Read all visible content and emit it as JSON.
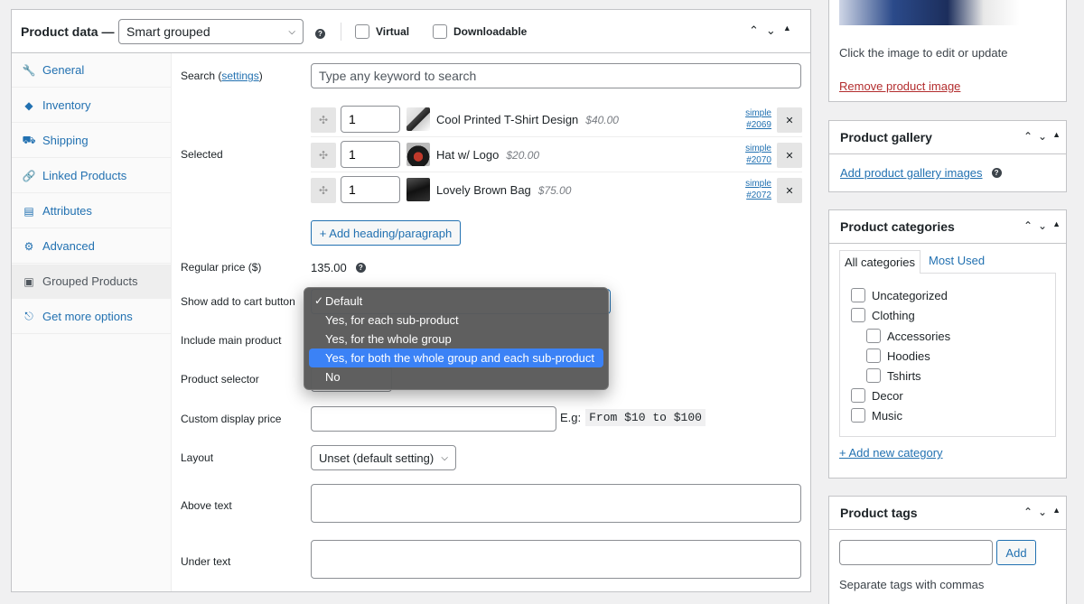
{
  "product_data": {
    "title": "Product data —",
    "type_select": "Smart grouped",
    "virtual_label": "Virtual",
    "downloadable_label": "Downloadable"
  },
  "tabs": [
    {
      "label": "General",
      "icon": "wrench-icon"
    },
    {
      "label": "Inventory",
      "icon": "tag-icon"
    },
    {
      "label": "Shipping",
      "icon": "truck-icon"
    },
    {
      "label": "Linked Products",
      "icon": "link-icon"
    },
    {
      "label": "Attributes",
      "icon": "list-icon"
    },
    {
      "label": "Advanced",
      "icon": "gear-icon"
    },
    {
      "label": "Grouped Products",
      "icon": "box-icon"
    },
    {
      "label": "Get more options",
      "icon": "plugin-icon"
    }
  ],
  "search": {
    "label_pre": "Search (",
    "label_link": "settings",
    "label_post": ")",
    "placeholder": "Type any keyword to search"
  },
  "selected": {
    "label": "Selected",
    "items": [
      {
        "qty": "1",
        "name": "Cool Printed T-Shirt Design",
        "price": "$40.00",
        "type": "simple",
        "id": "#2069"
      },
      {
        "qty": "1",
        "name": "Hat w/ Logo",
        "price": "$20.00",
        "type": "simple",
        "id": "#2070"
      },
      {
        "qty": "1",
        "name": "Lovely Brown Bag",
        "price": "$75.00",
        "type": "simple",
        "id": "#2072"
      }
    ],
    "add_heading_button": "+ Add heading/paragraph"
  },
  "regular_price": {
    "label": "Regular price ($)",
    "value": "135.00"
  },
  "add_to_cart": {
    "label": "Show add to cart button",
    "options": [
      {
        "label": "Default",
        "checked": true
      },
      {
        "label": "Yes, for each sub-product"
      },
      {
        "label": "Yes, for the whole group"
      },
      {
        "label": "Yes, for both the whole group and each sub-product",
        "highlighted": true
      },
      {
        "label": "No"
      }
    ]
  },
  "include_main": {
    "label": "Include main product"
  },
  "product_selector": {
    "label": "Product selector"
  },
  "custom_display_price": {
    "label": "Custom display price",
    "eg": "E.g:",
    "example": "From $10 to $100"
  },
  "layout": {
    "label": "Layout",
    "value": "Unset (default setting)"
  },
  "above_text": {
    "label": "Above text"
  },
  "under_text": {
    "label": "Under text"
  },
  "product_image": {
    "caption": "Click the image to edit or update",
    "remove_link": "Remove product image"
  },
  "gallery": {
    "title": "Product gallery",
    "add_link": "Add product gallery images"
  },
  "categories": {
    "title": "Product categories",
    "tab_all": "All categories",
    "tab_used": "Most Used",
    "items": [
      {
        "label": "Uncategorized",
        "level": 0
      },
      {
        "label": "Clothing",
        "level": 0
      },
      {
        "label": "Accessories",
        "level": 1
      },
      {
        "label": "Hoodies",
        "level": 1
      },
      {
        "label": "Tshirts",
        "level": 1
      },
      {
        "label": "Decor",
        "level": 0
      },
      {
        "label": "Music",
        "level": 0
      }
    ],
    "add_link": "+ Add new category"
  },
  "tags": {
    "title": "Product tags",
    "add_button": "Add",
    "hint": "Separate tags with commas"
  },
  "colors": {
    "link": "#2271b1",
    "highlight": "#3b82f6",
    "border": "#c3c4c7"
  }
}
